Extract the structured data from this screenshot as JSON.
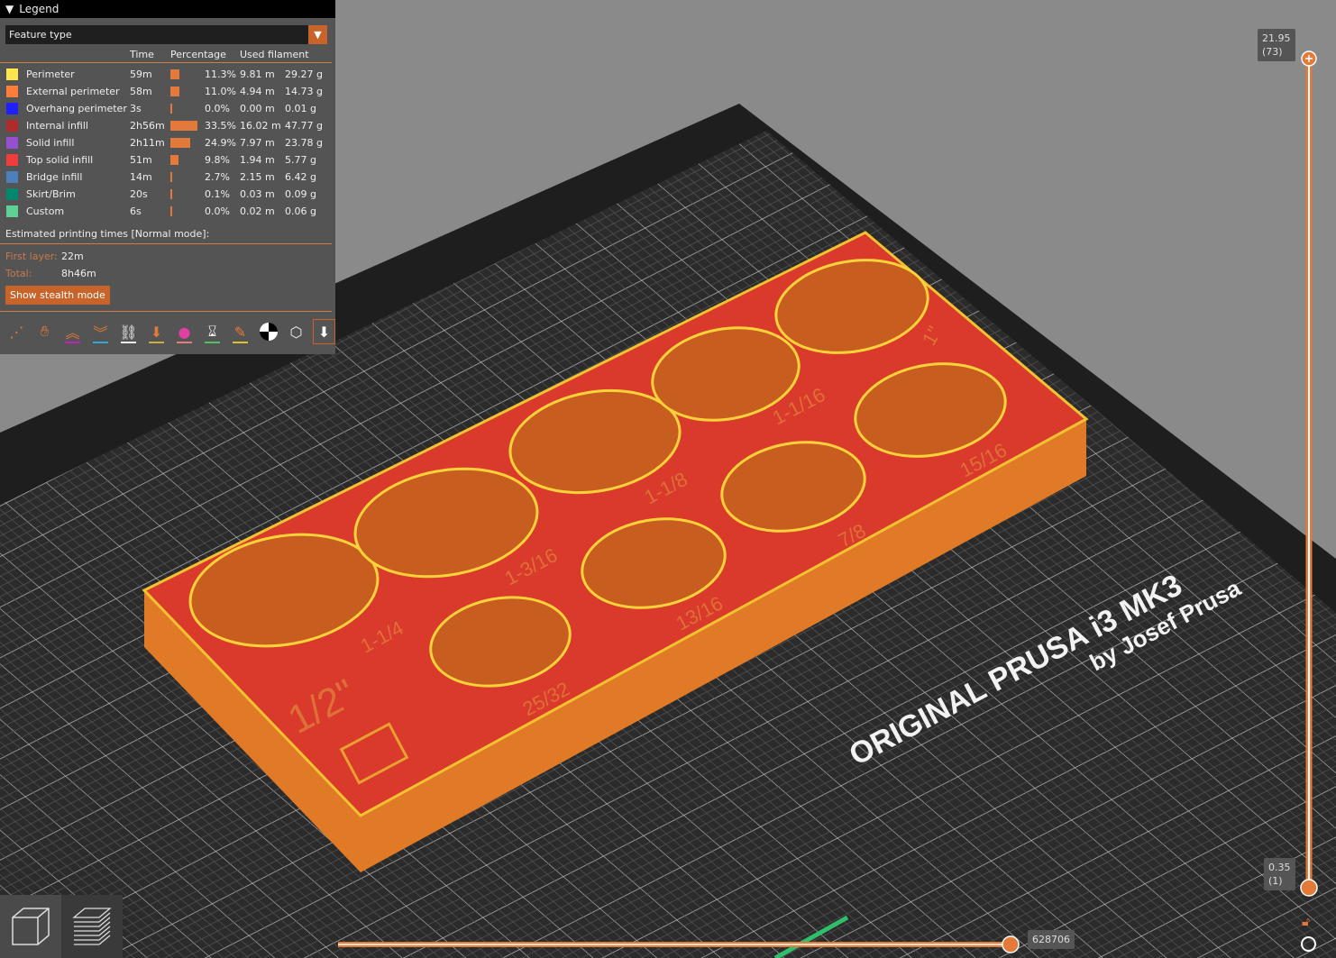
{
  "legend": {
    "title": "Legend",
    "view_type": "Feature type",
    "columns": {
      "time": "Time",
      "percentage": "Percentage",
      "used": "Used filament"
    },
    "rows": [
      {
        "name": "Perimeter",
        "color": "#ffe64d",
        "time": "59m",
        "pct": "11.3%",
        "pct_value": 11.3,
        "length": "9.81 m",
        "weight": "29.27 g"
      },
      {
        "name": "External perimeter",
        "color": "#ff7d38",
        "time": "58m",
        "pct": "11.0%",
        "pct_value": 11.0,
        "length": "4.94 m",
        "weight": "14.73 g"
      },
      {
        "name": "Overhang perimeter",
        "color": "#1f1fff",
        "time": "3s",
        "pct": "0.0%",
        "pct_value": 0.0,
        "length": "0.00 m",
        "weight": "0.01 g"
      },
      {
        "name": "Internal infill",
        "color": "#b02b2b",
        "time": "2h56m",
        "pct": "33.5%",
        "pct_value": 33.5,
        "length": "16.02 m",
        "weight": "47.77 g"
      },
      {
        "name": "Solid infill",
        "color": "#964fce",
        "time": "2h11m",
        "pct": "24.9%",
        "pct_value": 24.9,
        "length": "7.97 m",
        "weight": "23.78 g"
      },
      {
        "name": "Top solid infill",
        "color": "#f03c3c",
        "time": "51m",
        "pct": "9.8%",
        "pct_value": 9.8,
        "length": "1.94 m",
        "weight": "5.77 g"
      },
      {
        "name": "Bridge infill",
        "color": "#4d80ba",
        "time": "14m",
        "pct": "2.7%",
        "pct_value": 2.7,
        "length": "2.15 m",
        "weight": "6.42 g"
      },
      {
        "name": "Skirt/Brim",
        "color": "#00876e",
        "time": "20s",
        "pct": "0.1%",
        "pct_value": 0.1,
        "length": "0.03 m",
        "weight": "0.09 g"
      },
      {
        "name": "Custom",
        "color": "#5ed194",
        "time": "6s",
        "pct": "0.0%",
        "pct_value": 0.0,
        "length": "0.02 m",
        "weight": "0.06 g"
      }
    ],
    "estimated": "Estimated printing times [Normal mode]:",
    "first_layer_label": "First layer:",
    "first_layer": "22m",
    "total_label": "Total:",
    "total": "8h46m",
    "stealth_button": "Show stealth mode"
  },
  "toolbar": [
    "travel",
    "wipe",
    "retractions",
    "deretractions",
    "seams",
    "tool-changes",
    "color-changes",
    "pause-prints",
    "custom-gcodes",
    "center-of-gravity",
    "shells",
    "tool-marker"
  ],
  "vslider": {
    "top_value": "21.95",
    "top_layer": "(73)",
    "bottom_value": "0.35",
    "bottom_layer": "(1)"
  },
  "hslider": {
    "value": "628706"
  },
  "bed": {
    "line1": "ORIGINAL PRUSA i3 MK3",
    "line2": "by Josef Prusa"
  },
  "model_labels": [
    "1/2\"",
    "1-1/4",
    "1-3/16",
    "25/32",
    "1-1/8",
    "13/16",
    "1-1/16",
    "7/8",
    "1\"",
    "15/16"
  ]
}
